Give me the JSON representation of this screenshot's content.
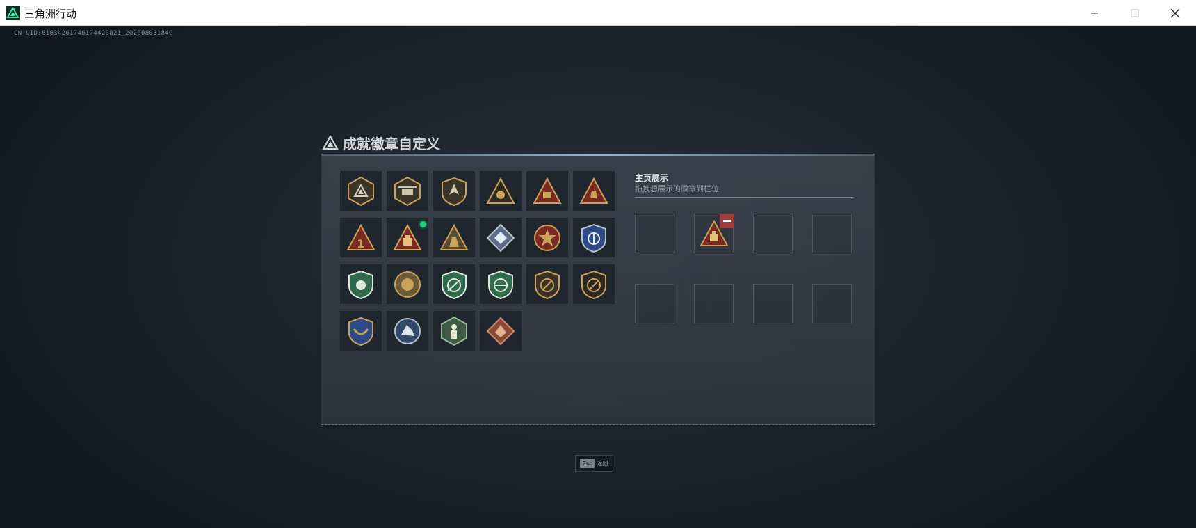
{
  "window": {
    "title": "三角洲行动",
    "minimize_icon": "minimize-icon",
    "maximize_icon": "maximize-icon",
    "close_icon": "close-icon"
  },
  "uid_text": "CN UID:8103426174617442G821_20260803184G",
  "panel": {
    "title": "成就徽章自定义",
    "title_icon": "delta-logo-icon"
  },
  "badges": [
    {
      "icon": "badge-triangle-shield-icon",
      "new": false
    },
    {
      "icon": "badge-helicopter-shield-icon",
      "new": false
    },
    {
      "icon": "badge-arrow-shield-icon",
      "new": false
    },
    {
      "icon": "badge-gold-triangle-crest-icon",
      "new": false
    },
    {
      "icon": "badge-gold-triangle-turret-icon",
      "new": false
    },
    {
      "icon": "badge-gold-triangle-hand-icon",
      "new": false
    },
    {
      "icon": "badge-triangle-number-one-icon",
      "new": false
    },
    {
      "icon": "badge-triangle-crate-icon",
      "new": true
    },
    {
      "icon": "badge-triangle-soldier-icon",
      "new": false
    },
    {
      "icon": "badge-diamond-crystal-icon",
      "new": false
    },
    {
      "icon": "badge-star-medal-icon",
      "new": false
    },
    {
      "icon": "badge-blue-police-shield-icon",
      "new": false
    },
    {
      "icon": "badge-green-eagle-shield-icon",
      "new": false
    },
    {
      "icon": "badge-round-wings-icon",
      "new": false
    },
    {
      "icon": "badge-green-scope-shield-icon",
      "new": false
    },
    {
      "icon": "badge-green-scope-rifle-icon",
      "new": false
    },
    {
      "icon": "badge-gold-knife-shield-icon",
      "new": false
    },
    {
      "icon": "badge-gold-knife-shield-dark-icon",
      "new": false
    },
    {
      "icon": "badge-gold-laurel-shield-icon",
      "new": false
    },
    {
      "icon": "badge-wolf-round-icon",
      "new": false
    },
    {
      "icon": "badge-green-hex-figure-icon",
      "new": false
    },
    {
      "icon": "badge-red-diamond-dragon-icon",
      "new": false
    }
  ],
  "showcase": {
    "title": "主页展示",
    "subtitle": "拖拽想展示的徽章到栏位",
    "slots": [
      "",
      "badge-triangle-crate-icon",
      "",
      "",
      "",
      "",
      "",
      ""
    ],
    "remove_icon": "remove-icon"
  },
  "esc_hint": {
    "key": "Esc",
    "label": "返回"
  },
  "colors": {
    "accent_green": "#1fd47a",
    "gold": "#c9a35a",
    "remove_red": "#9e3c3c"
  }
}
